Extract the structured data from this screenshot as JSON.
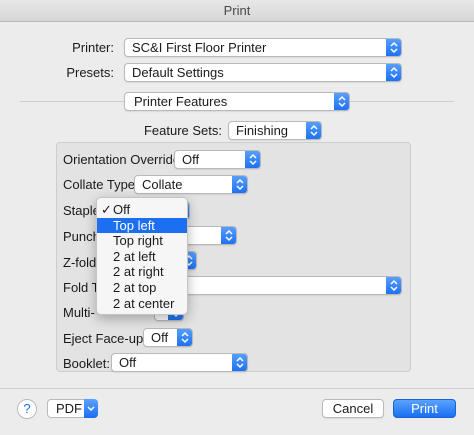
{
  "window": {
    "title": "Print"
  },
  "printer": {
    "label": "Printer:",
    "value": "SC&I First Floor Printer"
  },
  "presets": {
    "label": "Presets:",
    "value": "Default Settings"
  },
  "section_popup": {
    "value": "Printer Features"
  },
  "feature_sets": {
    "label": "Feature Sets:",
    "value": "Finishing"
  },
  "fields": {
    "orientation": {
      "label": "Orientation Override:",
      "value": "Off"
    },
    "collate": {
      "label": "Collate Type:",
      "value": "Collate"
    },
    "staple": {
      "label": "Staple"
    },
    "punch": {
      "label": "Punch"
    },
    "zfold": {
      "label": "Z-fold"
    },
    "fold_type": {
      "label": "Fold Ty"
    },
    "multi": {
      "label": "Multi-"
    },
    "eject": {
      "label": "Eject Face-up:",
      "value": "Off"
    },
    "booklet": {
      "label": "Booklet:",
      "value": "Off"
    }
  },
  "staple_menu": {
    "items": [
      {
        "label": "Off",
        "checked": true,
        "selected": false
      },
      {
        "label": "Top left",
        "checked": false,
        "selected": true
      },
      {
        "label": "Top right",
        "checked": false,
        "selected": false
      },
      {
        "label": "2 at left",
        "checked": false,
        "selected": false
      },
      {
        "label": "2 at right",
        "checked": false,
        "selected": false
      },
      {
        "label": "2 at top",
        "checked": false,
        "selected": false
      },
      {
        "label": "2 at center",
        "checked": false,
        "selected": false
      }
    ],
    "check_glyph": "✓"
  },
  "footer": {
    "help_glyph": "?",
    "pdf_label": "PDF",
    "cancel_label": "Cancel",
    "print_label": "Print"
  },
  "colors": {
    "accent": "#1b6ff0",
    "window_bg": "#ececec"
  }
}
